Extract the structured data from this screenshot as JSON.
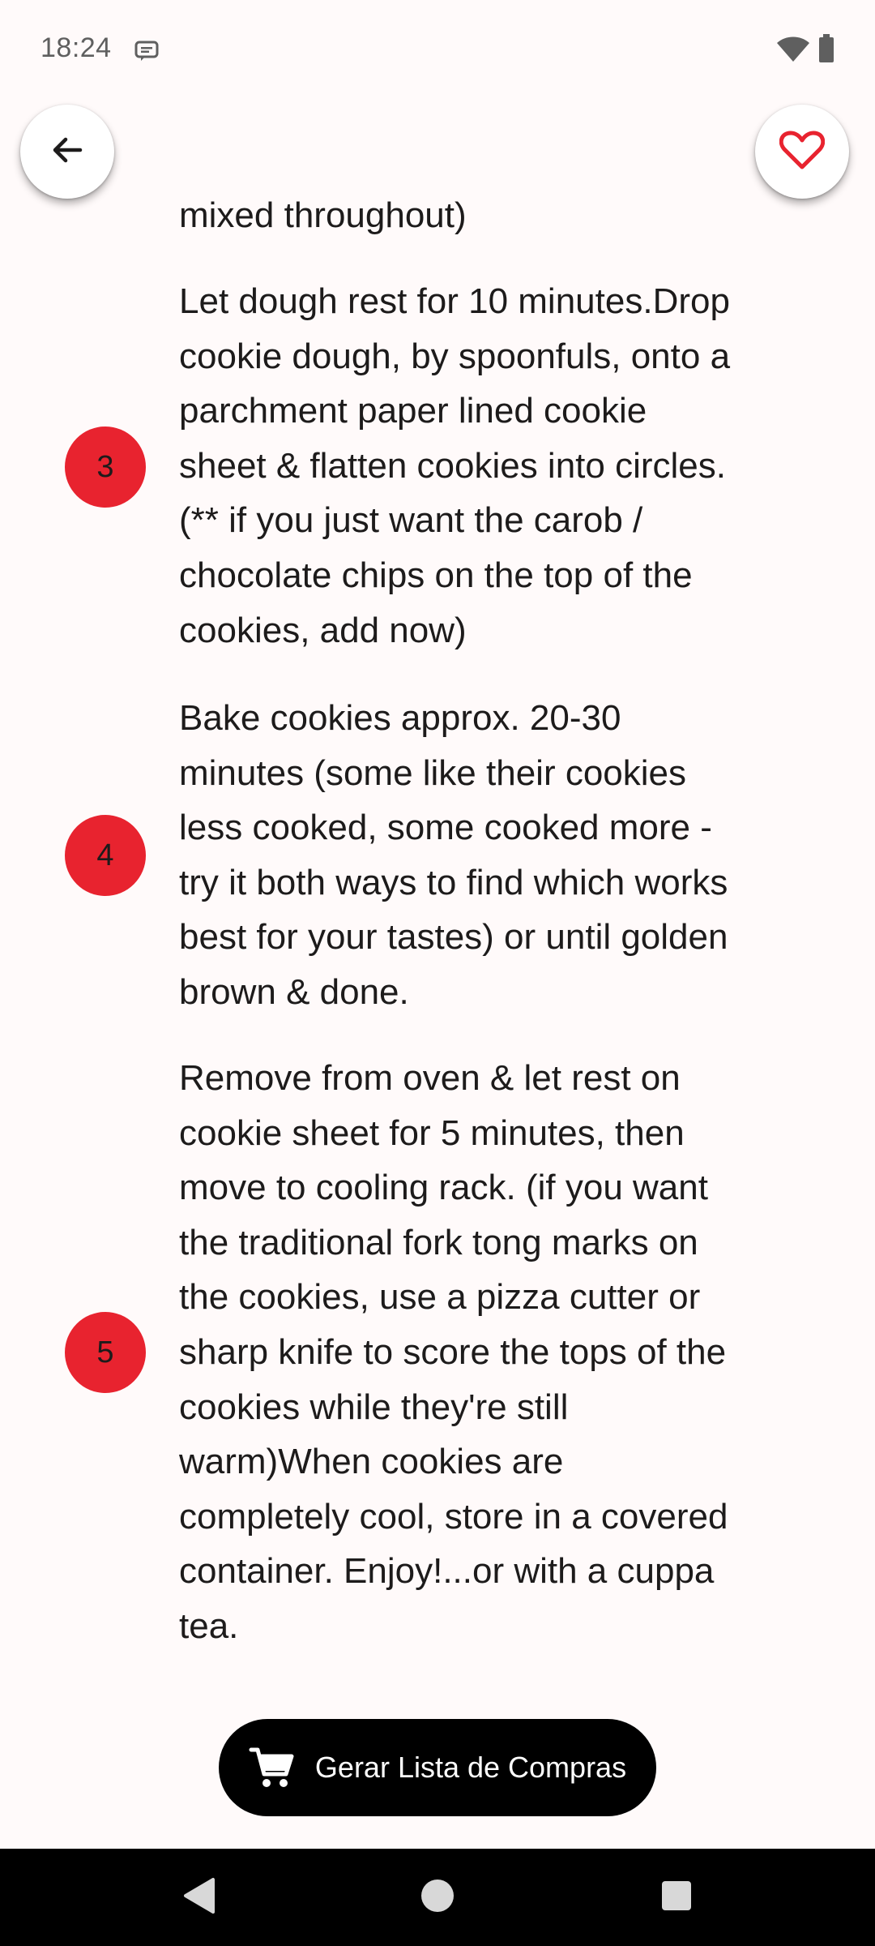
{
  "status_bar": {
    "time": "18:24",
    "icons": [
      "message-icon",
      "wifi-icon",
      "battery-icon"
    ]
  },
  "top_actions": {
    "back_icon": "arrow-back-icon",
    "favorite_icon": "heart-outline-icon",
    "favorite_color": "#e8232f"
  },
  "steps": {
    "partial_text": "mixed throughout)",
    "items": [
      {
        "number": "3",
        "text": "Let dough rest for 10 minutes.Drop\ncookie dough, by spoonfuls, onto a\nparchment paper lined cookie\nsheet & flatten cookies into circles.\n(** if you just want the carob /\nchocolate chips on the top of the\ncookies, add now)"
      },
      {
        "number": "4",
        "text": "Bake cookies approx. 20-30\nminutes (some like their cookies\nless cooked, some cooked more -\ntry it both ways to find which works\nbest for your tastes) or until golden\nbrown & done."
      },
      {
        "number": "5",
        "text": "Remove from oven & let rest on\ncookie sheet for 5 minutes, then\nmove to cooling rack. (if you want\nthe traditional fork tong marks on\nthe cookies, use a pizza cutter or\nsharp knife to score the tops of the\ncookies while they're still\nwarm)When cookies are\ncompletely cool, store in a covered\ncontainer. Enjoy!...or with a cuppa\ntea."
      }
    ],
    "badge_color": "#e8232f"
  },
  "shopping_button": {
    "label": "Gerar Lista de Compras",
    "icon": "shopping-cart-icon"
  },
  "nav_bar": {
    "buttons": [
      "nav-back-icon",
      "nav-home-icon",
      "nav-recents-icon"
    ]
  }
}
